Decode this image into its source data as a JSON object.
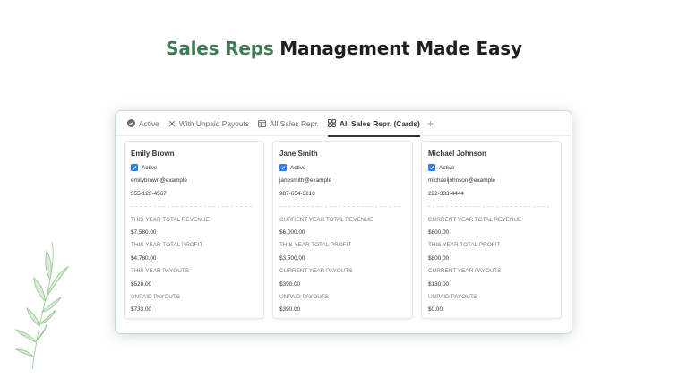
{
  "headline": {
    "accent": "Sales Reps",
    "rest": " Management Made Easy"
  },
  "tabs": [
    {
      "label": "Active",
      "icon": "check-circle-icon"
    },
    {
      "label": "With Unpaid Payouts",
      "icon": "x-icon"
    },
    {
      "label": "All Sales Repr.",
      "icon": "table-icon"
    },
    {
      "label": "All Sales Repr. (Cards)",
      "icon": "gallery-icon",
      "active": true
    }
  ],
  "tab_add": "+",
  "divider": "- - - - - - - - - - - - - - - - - - - - - - - - - - -",
  "cards": [
    {
      "name": "Emily Brown",
      "status": "Active",
      "email": "emilybrown@example",
      "phone": "555-123-4567",
      "revenue_label": "THIS YEAR TOTAL REVENUE",
      "revenue": "$7,580.00",
      "profit_label": "THIS YEAR TOTAL PROFIT",
      "profit": "$4,780.00",
      "payouts_label": "THIS YEAR PAYOUTS",
      "payouts": "$528.00",
      "unpaid_label": "UNPAID PAYOUTS",
      "unpaid": "$733.00"
    },
    {
      "name": "Jane Smith",
      "status": "Active",
      "email": "janesmith@example",
      "phone": "987-654-3210",
      "revenue_label": "CURRENT YEAR TOTAL REVENUE",
      "revenue": "$6,000.00",
      "profit_label": "THIS YEAR TOTAL PROFIT",
      "profit": "$3,500.00",
      "payouts_label": "CURRENT YEAR PAYOUTS",
      "payouts": "$390.00",
      "unpaid_label": "UNPAID PAYOUTS",
      "unpaid": "$390.00"
    },
    {
      "name": "Michael Johnson",
      "status": "Active",
      "email": "michaeljohnson@example",
      "phone": "222-333-4444",
      "revenue_label": "CURRENT YEAR TOTAL REVENUE",
      "revenue": "$800.00",
      "profit_label": "THIS YEAR TOTAL PROFIT",
      "profit": "$800.00",
      "payouts_label": "CURRENT YEAR PAYOUTS",
      "payouts": "$130.00",
      "unpaid_label": "UNPAID PAYOUTS",
      "unpaid": "$0.00"
    }
  ],
  "colors": {
    "accent": "#3e7a55",
    "checkbox": "#2f80ed",
    "leaf": "#a9d3a6"
  }
}
